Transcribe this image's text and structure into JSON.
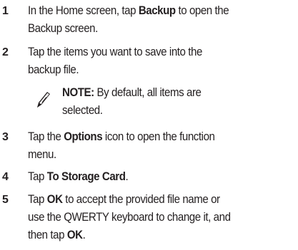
{
  "steps": [
    {
      "number": "1",
      "line1_pre": "In the Home screen, tap ",
      "line1_bold": "Backup",
      "line1_post": " to open the",
      "line2": "Backup screen."
    },
    {
      "number": "2",
      "line1": "Tap the items you want to save into the",
      "line2": "backup file."
    },
    {
      "number": "3",
      "line1_pre": "Tap the ",
      "line1_bold": "Options",
      "line1_post": " icon to open the function",
      "line2": "menu."
    },
    {
      "number": "4",
      "line1_pre": "Tap ",
      "line1_bold": "To Storage Card",
      "line1_post": "."
    },
    {
      "number": "5",
      "line1_pre": "Tap ",
      "line1_bold": "OK",
      "line1_post": " to accept the provided file name or",
      "line2": "use the QWERTY keyboard to change it, and",
      "line3_pre": "then tap ",
      "line3_bold": "OK",
      "line3_post": "."
    }
  ],
  "note": {
    "label": "NOTE:",
    "line1": " By default, all items are",
    "line2": "selected.",
    "icon": "pencil-note-icon"
  }
}
